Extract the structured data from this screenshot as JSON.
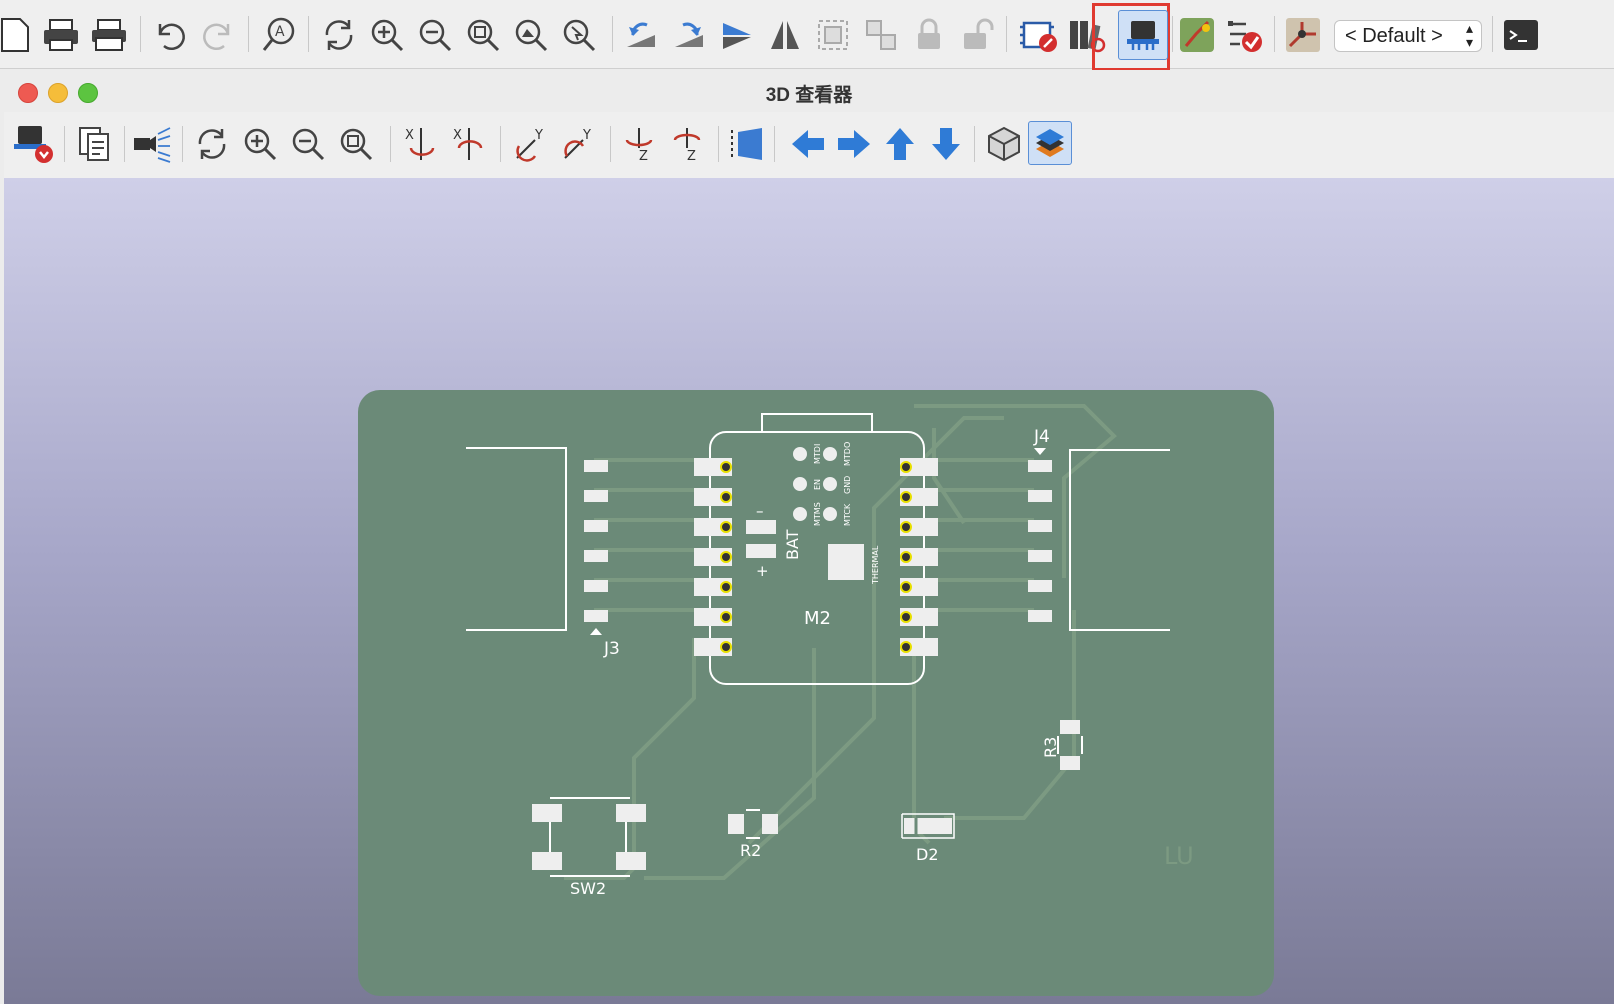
{
  "main_toolbar": {
    "layer_select_value": "< Default >",
    "highlighted_tool": "3d-viewer-icon"
  },
  "viewer": {
    "window_title": "3D 查看器"
  },
  "pcb": {
    "labels": {
      "j3": "J3",
      "j4": "J4",
      "m2": "M2",
      "bat": "BAT",
      "bat_minus": "–",
      "bat_plus": "+",
      "r2": "R2",
      "r3": "R3",
      "d2": "D2",
      "sw2": "SW2",
      "lu": "LU",
      "thermal": "THERMAL",
      "mtdi": "MTDI",
      "mtdo": "MTDO",
      "en": "EN",
      "gnd": "GND",
      "mtms": "MTMS",
      "mtck": "MTCK"
    },
    "colors": {
      "board": "#6b8a78",
      "trace": "#7c9a82",
      "silk": "#ffffff",
      "pad": "#eeeeee",
      "via_ring": "#e8e000"
    }
  }
}
